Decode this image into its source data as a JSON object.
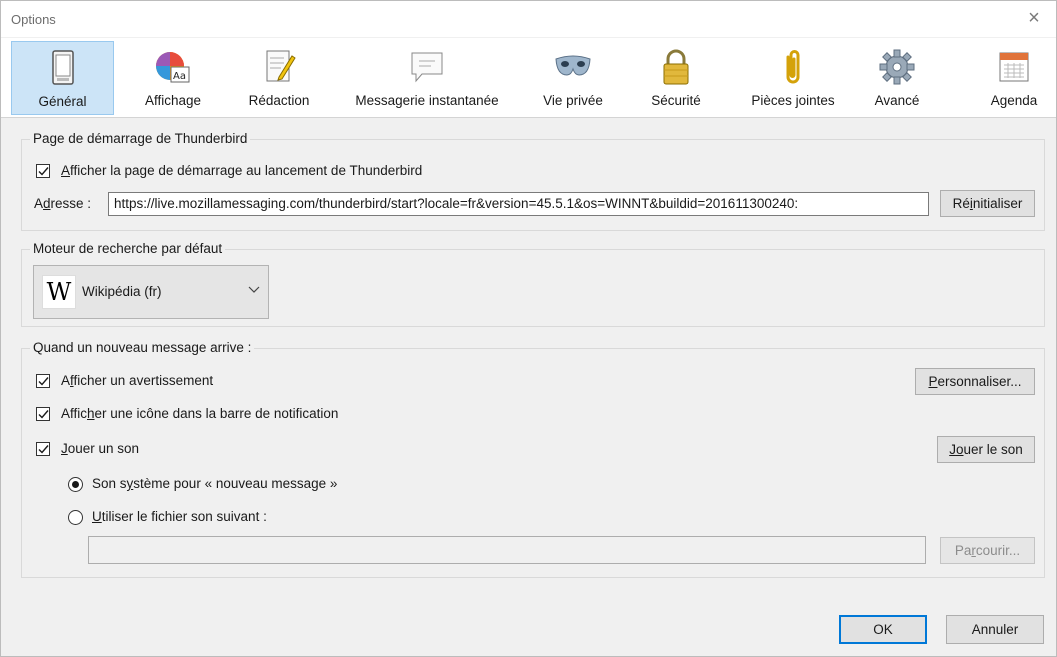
{
  "window": {
    "title": "Options",
    "close_glyph": "×"
  },
  "toolbar": {
    "items": [
      {
        "label": "Général",
        "icon": "general-window-icon",
        "selected": true
      },
      {
        "label": "Affichage",
        "icon": "display-palette-icon",
        "selected": false
      },
      {
        "label": "Rédaction",
        "icon": "compose-pencil-icon",
        "selected": false
      },
      {
        "label": "Messagerie instantanée",
        "icon": "chat-bubble-icon",
        "selected": false
      },
      {
        "label": "Vie privée",
        "icon": "privacy-mask-icon",
        "selected": false
      },
      {
        "label": "Sécurité",
        "icon": "security-lock-icon",
        "selected": false
      },
      {
        "label": "Pièces jointes",
        "icon": "attachment-paperclip-icon",
        "selected": false
      },
      {
        "label": "Avancé",
        "icon": "advanced-gear-icon",
        "selected": false
      },
      {
        "label": "Agenda",
        "icon": "calendar-icon",
        "selected": false
      }
    ]
  },
  "startup": {
    "group_title": "Page de démarrage de Thunderbird",
    "show_start_checkbox": {
      "checked": true,
      "label_a": "A",
      "label_b": "fficher la page de démarrage au lancement de Thunderbird"
    },
    "address_label_a": "A",
    "address_label_b": "d",
    "address_label_c": "resse :",
    "address_value": "https://live.mozillamessaging.com/thunderbird/start?locale=fr&version=45.5.1&os=WINNT&buildid=201611300240:",
    "reset_a": "Ré",
    "reset_b": "i",
    "reset_c": "nitialiser"
  },
  "search": {
    "group_title": "Moteur de recherche par défaut",
    "engine_logo": "W",
    "engine_name": "Wikipédia (fr)"
  },
  "new_message": {
    "group_title": "Quand un nouveau message arrive :",
    "alert": {
      "checked": true,
      "a": "A",
      "b": "f",
      "c": "ficher un avertissement"
    },
    "customize_a": "P",
    "customize_b": "ersonnaliser...",
    "tray": {
      "checked": true,
      "a": "Affic",
      "b": "h",
      "c": "er une icône dans la barre de notification"
    },
    "sound": {
      "checked": true,
      "a": "J",
      "b": "ouer un son"
    },
    "play_a": "J",
    "play_b": "o",
    "play_c": "uer le son",
    "system_sound": {
      "selected": true,
      "a": "Son s",
      "b": "y",
      "c": "stème pour « nouveau message »"
    },
    "custom_sound": {
      "selected": false,
      "a": "U",
      "b": "tiliser le fichier son suivant :"
    },
    "file_value": "",
    "browse_a": "Pa",
    "browse_b": "r",
    "browse_c": "courir..."
  },
  "footer": {
    "ok": "OK",
    "cancel": "Annuler"
  },
  "colors": {
    "selection_bg": "#cce4f7",
    "selection_border": "#99c9ef",
    "default_button_border": "#0078d7",
    "dialog_bg": "#f0f0f0"
  }
}
